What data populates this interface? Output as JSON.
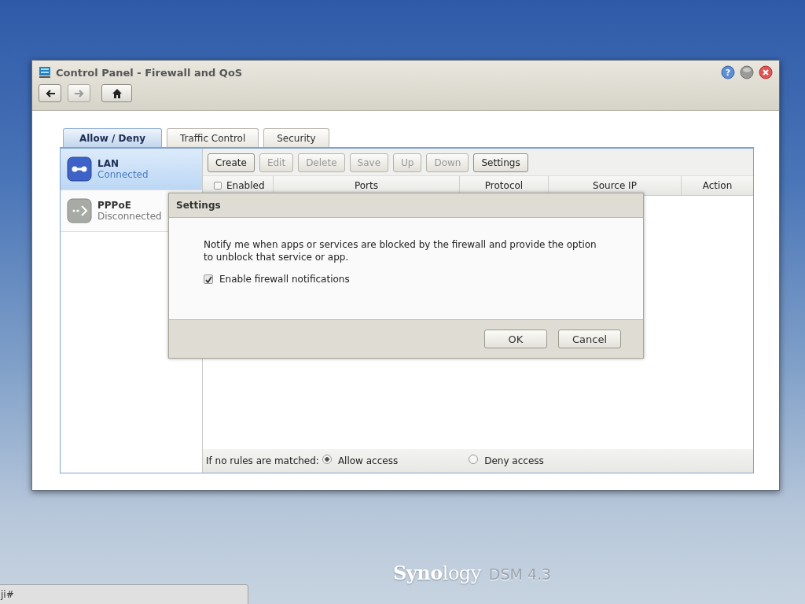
{
  "window": {
    "title": "Control Panel - Firewall and QoS",
    "title_buttons": [
      {
        "kind": "help",
        "symbol": "?"
      },
      {
        "kind": "minimize"
      },
      {
        "kind": "close"
      }
    ],
    "nav_buttons": [
      {
        "kind": "back",
        "disabled": false
      },
      {
        "kind": "forward",
        "disabled": true
      },
      {
        "kind": "home",
        "disabled": false
      }
    ]
  },
  "tabs": [
    {
      "label": "Allow / Deny",
      "selected": true
    },
    {
      "label": "Traffic Control",
      "selected": false
    },
    {
      "label": "Security",
      "selected": false
    }
  ],
  "interfaces": [
    {
      "kind": "lan",
      "name": "LAN",
      "status": "Connected",
      "selected": true
    },
    {
      "kind": "pppoe",
      "name": "PPPoE",
      "status": "Disconnected",
      "selected": false
    }
  ],
  "toolbar": [
    {
      "label": "Create",
      "disabled": false
    },
    {
      "label": "Edit",
      "disabled": true
    },
    {
      "label": "Delete",
      "disabled": true
    },
    {
      "label": "Save",
      "disabled": true
    },
    {
      "label": "Up",
      "disabled": true
    },
    {
      "label": "Down",
      "disabled": true
    },
    {
      "label": "Settings",
      "disabled": false
    }
  ],
  "table": {
    "columns": [
      {
        "kind": "checkbox",
        "label": "Enabled",
        "checked": false
      },
      {
        "kind": "text",
        "label": "Ports"
      },
      {
        "kind": "text",
        "label": "Protocol"
      },
      {
        "kind": "text",
        "label": "Source IP"
      },
      {
        "kind": "text",
        "label": "Action"
      }
    ]
  },
  "footer": {
    "label": "If no rules are matched:",
    "options": [
      {
        "label": "Allow access",
        "selected": true
      },
      {
        "label": "Deny access",
        "selected": false
      }
    ]
  },
  "dialog": {
    "title": "Settings",
    "message": "Notify me when apps or services are blocked by the firewall and provide the option to unblock that service or app.",
    "checkbox": {
      "label": "Enable firewall notifications",
      "checked": true
    },
    "buttons": [
      "OK",
      "Cancel"
    ]
  },
  "taskbar": {
    "text": "ji#"
  },
  "branding": {
    "logo": "**Syno**logy",
    "product": "DSM 4.3"
  }
}
